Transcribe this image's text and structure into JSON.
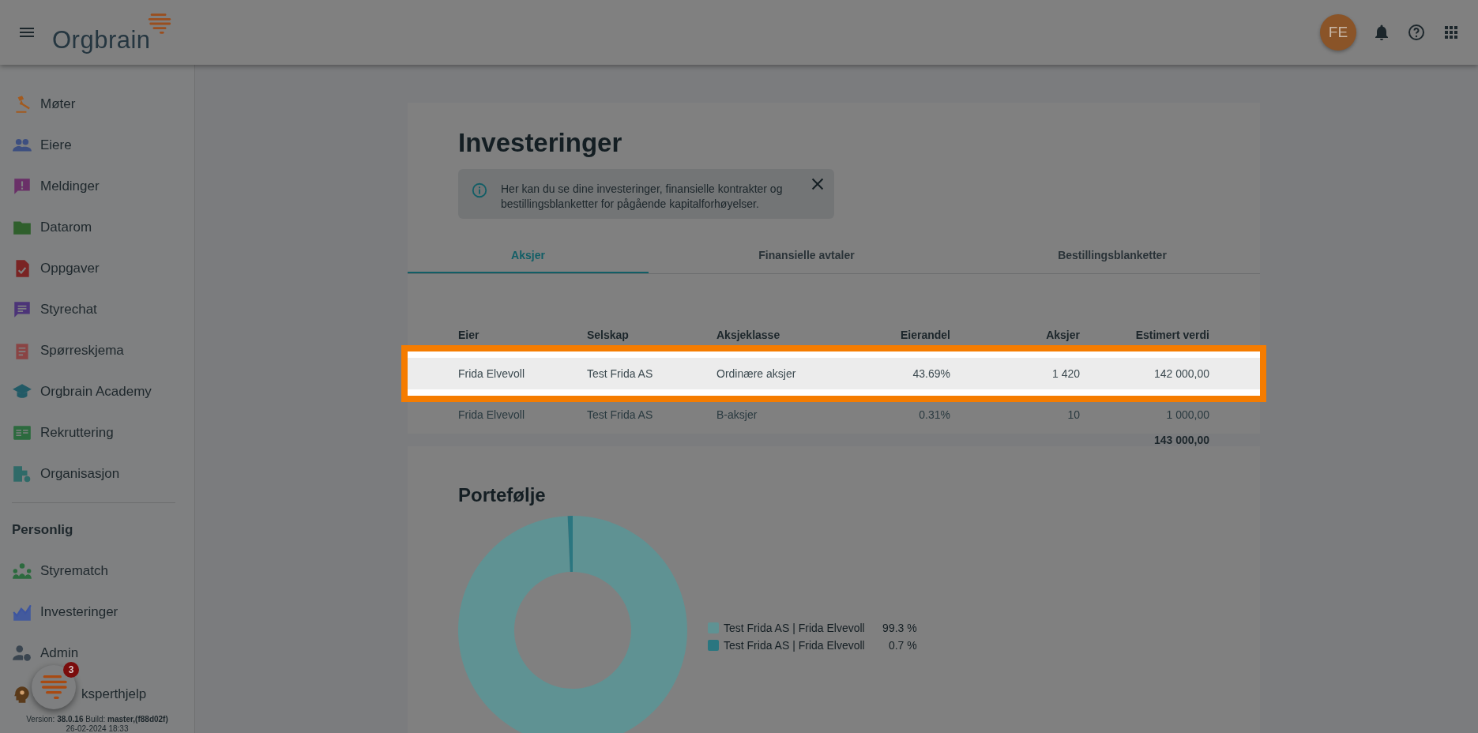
{
  "header": {
    "logo": "Orgbrain",
    "avatar": "FE"
  },
  "sidebar": {
    "items": [
      {
        "label": "Møter",
        "color": "#a35a1e"
      },
      {
        "label": "Eiere",
        "color": "#3d4f80"
      },
      {
        "label": "Meldinger",
        "color": "#6a3068"
      },
      {
        "label": "Datarom",
        "color": "#2f5f2c"
      },
      {
        "label": "Oppgaver",
        "color": "#7a2424"
      },
      {
        "label": "Styrechat",
        "color": "#4c3478"
      },
      {
        "label": "Spørreskjema",
        "color": "#8a4444"
      },
      {
        "label": "Orgbrain Academy",
        "color": "#225a66"
      },
      {
        "label": "Rekruttering",
        "color": "#2c6a3e"
      },
      {
        "label": "Organisasjon",
        "color": "#2f6a68"
      }
    ],
    "section": "Personlig",
    "personal_items": [
      {
        "label": "Styrematch",
        "color": "#2c6a3e"
      },
      {
        "label": "Investeringer",
        "color": "#3d55a0"
      },
      {
        "label": "Admin",
        "color": "#3a4550"
      },
      {
        "label": "ksperthjelp",
        "color": "#5a3a1a"
      }
    ],
    "version": "Version: **38.0.16** Build: **master,(f88d02f)**",
    "date": "26-02-2024 18:33"
  },
  "chat": {
    "badge": "3"
  },
  "page": {
    "title": "Investeringer",
    "info": "Her kan du se dine investeringer, finansielle kontrakter og bestillingsblanketter for pågående kapitalforhøyelser.",
    "tabs": [
      {
        "label": "Aksjer",
        "selected": true
      },
      {
        "label": "Finansielle avtaler",
        "selected": false
      },
      {
        "label": "Bestillingsblanketter",
        "selected": false
      }
    ],
    "table": {
      "columns": [
        "Eier",
        "Selskap",
        "Aksjeklasse",
        "Eierandel",
        "Aksjer",
        "Estimert verdi"
      ],
      "rows": [
        {
          "cells": [
            "Frida Elvevoll",
            "Test Frida AS",
            "Ordinære aksjer",
            "43.69%",
            "1 420",
            "142 000,00"
          ],
          "highlighted": true
        },
        {
          "cells": [
            "Frida Elvevoll",
            "Test Frida AS",
            "B-aksjer",
            "0.31%",
            "10",
            "1 000,00"
          ],
          "highlighted": false
        }
      ],
      "total": "143 000,00"
    }
  },
  "portfolio": {
    "title": "Portefølje",
    "legend": [
      {
        "value": "99.3 %",
        "color": "#5f9293"
      },
      {
        "value": "0.7 %",
        "color": "#2a7680"
      }
    ],
    "chart_data": {
      "type": "donut",
      "categories": [
        "Test Frida AS | Frida Elvevoll",
        "Test Frida AS | Frida Elvevoll"
      ],
      "values": [
        99.3,
        0.7
      ]
    }
  }
}
